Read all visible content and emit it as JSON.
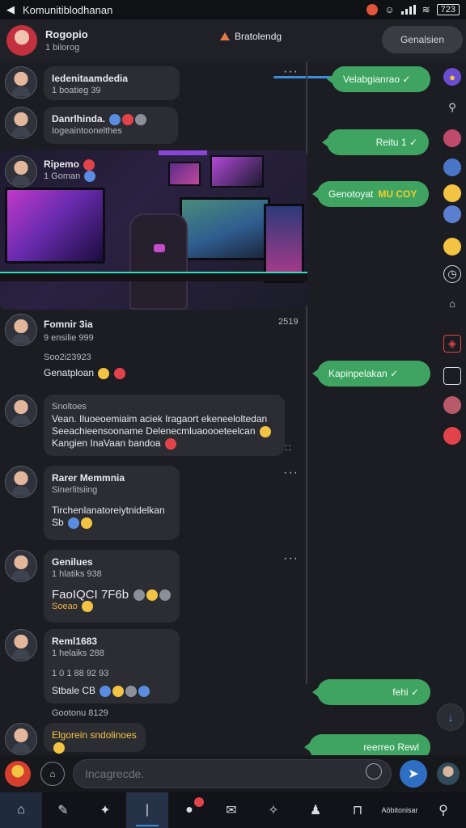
{
  "status_bar": {
    "title": "Komunitiblodhanan",
    "battery": "723"
  },
  "header": {
    "contact_name": "Rogopio",
    "contact_sub": "1 bilorog",
    "tab_label": "Bratolendg",
    "right_button": "Genalsien"
  },
  "messages": [
    {
      "name": "Iedenitaamdedia",
      "sub": "1 boatieg 39"
    },
    {
      "name": "Danrlhinda.",
      "sub": "Iogeaintoonelthes"
    },
    {
      "name": "Ripemo",
      "sub": "1 Goman"
    },
    {
      "name": "Fomnir 3ia",
      "sub": "9 ensilie 999",
      "line1": "Soo2i23923",
      "line2": "Genatploan",
      "time": "2519"
    },
    {
      "name": "Snoltoes",
      "sub": "",
      "line1": "Vean. Iluoeoemiaim aciek Iragaort ekeneeloltedan",
      "line2": "Seeachieensooname  Delenecmluaoooeteelcan",
      "line3": "Kangien InaVaan  bandoa"
    },
    {
      "name": "Rarer Memmnia",
      "sub": "Sinerlitsiing",
      "line1": "Tirchenlanatoreiytnidelkan",
      "line2": "Sb"
    },
    {
      "name": "Genilues",
      "sub": "1 hlatiks 938",
      "line1": "FaoIQCI 7F6b",
      "line2": "Soeao"
    },
    {
      "name": "Reml1683",
      "sub": "1 helaiks 288",
      "line1": "1 0 1 88 92 93",
      "line2": "Stbale  CB"
    },
    {
      "name": "",
      "sub": "",
      "line1": "Gootonu 8129"
    },
    {
      "name": "",
      "sub": "",
      "line1": "Elgorein sndolinoes"
    }
  ],
  "outgoing": [
    {
      "text": "Velabgianrao"
    },
    {
      "text": "Reitu 1"
    },
    {
      "text": "Genotoyat",
      "highlight": "MU COY"
    },
    {
      "text": "Kapinpelakan"
    },
    {
      "text": "fehi"
    },
    {
      "text": "reerreo Rewl"
    }
  ],
  "composer": {
    "placeholder": "Incagrecde."
  },
  "nav": {
    "last_label": "Aöbitonisar"
  },
  "colors": {
    "accent": "#3b8edc",
    "outgoing": "#3fa462",
    "background": "#1c1d22"
  }
}
